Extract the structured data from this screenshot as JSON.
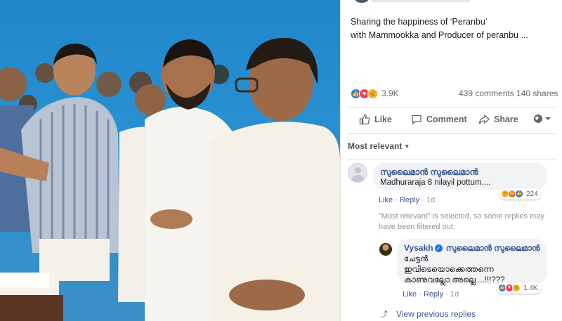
{
  "post": {
    "caption_line1": "Sharing the happiness of ‘Peranbu’",
    "caption_line2": "with Mammookka and Producer of peranbu ..."
  },
  "stats": {
    "reaction_count": "3.9K",
    "comments": "439 comments",
    "shares": "140 shares"
  },
  "actions": {
    "like": "Like",
    "comment": "Comment",
    "share": "Share"
  },
  "comment_filter": "Most relevant",
  "comments": [
    {
      "author": "സുലൈമാൻ സുലൈമാൻ",
      "text": "Madhuraraja 8 nilayil pottum....",
      "reaction_count": "224",
      "like": "Like",
      "reply": "Reply",
      "time": "1d"
    }
  ],
  "filter_note": "\"Most relevant\" is selected, so some replies may have been filtered out.",
  "reply": {
    "author": "Vysakh",
    "tag": "സുലൈമാൻ സുലൈമാൻ",
    "text_line1": "ചേട്ടൻ",
    "text_line2": "ഇവിടെയൊക്കെത്തന്നെ",
    "text_line3": "കാണുവല്ലോ അല്ലെ ...!!!???",
    "reaction_count": "1.4K",
    "like": "Like",
    "reply": "Reply",
    "time": "1d"
  },
  "view_previous": "View previous replies",
  "colors": {
    "facebook_blue": "#1877f2",
    "link_blue": "#385898",
    "photo_background": "#2a92d3"
  }
}
